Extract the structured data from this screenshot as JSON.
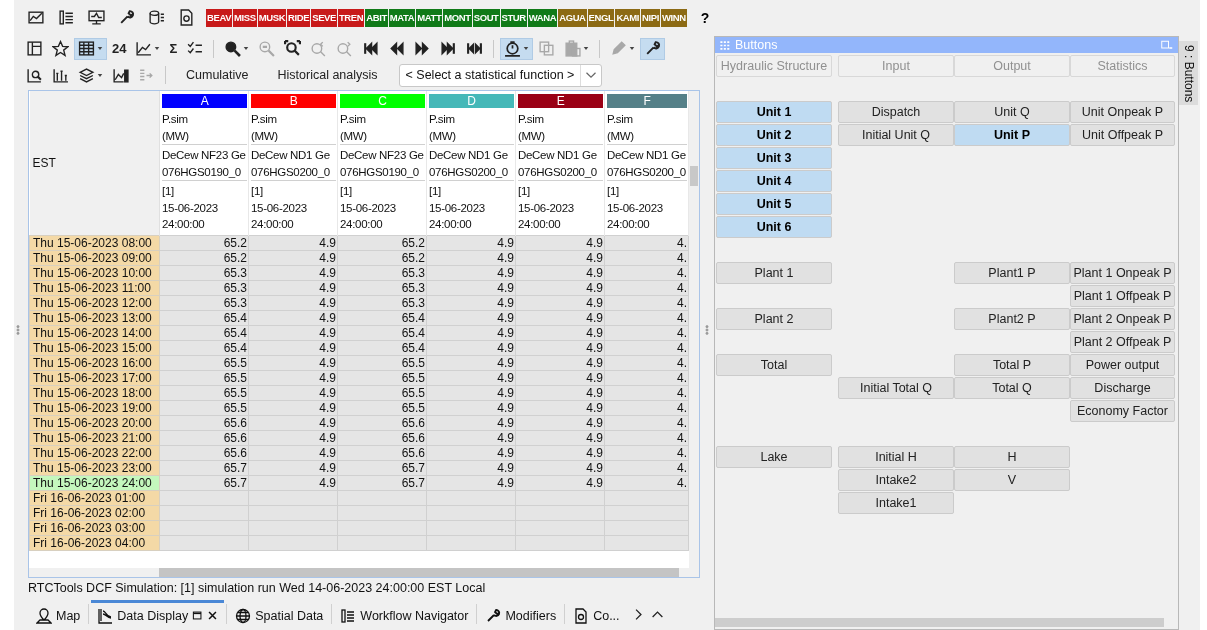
{
  "toolbar_1": {
    "groups": [
      {
        "items": [
          {
            "kind": "chart",
            "selected": false
          },
          {
            "kind": "list",
            "selected": false
          },
          {
            "kind": "monitor",
            "selected": false
          },
          {
            "kind": "wrench",
            "selected": false
          },
          {
            "kind": "database",
            "selected": false
          },
          {
            "kind": "document",
            "selected": false
          }
        ]
      }
    ],
    "tags": [
      {
        "label": "BEAV",
        "color": "#c81a1a"
      },
      {
        "label": "MISS",
        "color": "#c81a1a"
      },
      {
        "label": "MUSK",
        "color": "#c81a1a"
      },
      {
        "label": "RIDE",
        "color": "#c81a1a"
      },
      {
        "label": "SEVE",
        "color": "#c81a1a"
      },
      {
        "label": "TREN",
        "color": "#c81a1a"
      },
      {
        "label": "ABIT",
        "color": "#107a18"
      },
      {
        "label": "MATA",
        "color": "#107a18"
      },
      {
        "label": "MATT",
        "color": "#107a18"
      },
      {
        "label": "MONT",
        "color": "#107a18"
      },
      {
        "label": "SOUT",
        "color": "#107a18"
      },
      {
        "label": "STUR",
        "color": "#107a18"
      },
      {
        "label": "WANA",
        "color": "#107a18"
      },
      {
        "label": "AGUA",
        "color": "#8c6a14"
      },
      {
        "label": "ENGL",
        "color": "#8c6a14"
      },
      {
        "label": "KAMI",
        "color": "#8c6a14"
      },
      {
        "label": "NIPI",
        "color": "#8c6a14"
      },
      {
        "label": "WINN",
        "color": "#8c6a14"
      }
    ],
    "help": "?"
  },
  "toolbar_2": {
    "groups": [
      {
        "items": [
          {
            "kind": "layout",
            "selected": false
          },
          {
            "kind": "star",
            "selected": false
          },
          {
            "kind": "table",
            "selected": true,
            "dropdown": true
          },
          {
            "kind": "text",
            "label": "24",
            "selected": false
          },
          {
            "kind": "line-chart",
            "selected": false,
            "dropdown": true
          },
          {
            "kind": "text",
            "label": "Σ",
            "selected": false
          },
          {
            "kind": "checklist",
            "selected": false
          }
        ]
      },
      {
        "items": [
          {
            "kind": "zoom-in",
            "selected": false,
            "dropdown": true
          },
          {
            "kind": "zoom-out",
            "selected": false,
            "disabled": true
          },
          {
            "kind": "zoom-fit",
            "selected": false
          },
          {
            "kind": "zoom-back",
            "selected": false,
            "disabled": true
          },
          {
            "kind": "zoom-forward",
            "selected": false,
            "disabled": true
          },
          {
            "kind": "first",
            "selected": false
          },
          {
            "kind": "previous",
            "selected": false
          },
          {
            "kind": "next",
            "selected": false
          },
          {
            "kind": "last",
            "selected": false
          },
          {
            "kind": "skip",
            "selected": false
          }
        ]
      },
      {
        "items": [
          {
            "kind": "timer",
            "selected": true,
            "dropdown": true
          },
          {
            "kind": "copy",
            "selected": false,
            "disabled": true
          },
          {
            "kind": "paste",
            "selected": false,
            "disabled": true,
            "dropdown": true
          }
        ]
      },
      {
        "items": [
          {
            "kind": "pencil",
            "selected": false,
            "disabled": true,
            "dropdown": true
          },
          {
            "kind": "wrench",
            "selected": true
          }
        ]
      }
    ]
  },
  "toolbar_3": {
    "groups": [
      {
        "items": [
          {
            "kind": "chart-search",
            "selected": false
          },
          {
            "kind": "bar-axes",
            "selected": false
          },
          {
            "kind": "layers",
            "selected": false,
            "dropdown": true
          },
          {
            "kind": "chart-bars",
            "selected": false
          },
          {
            "kind": "arrow-list",
            "selected": false,
            "disabled": true
          }
        ]
      }
    ],
    "buttons": [
      "Cumulative",
      "Historical analysis"
    ],
    "statistic_select": {
      "value": "< Select a statistical function >"
    }
  },
  "table": {
    "corner": "EST",
    "columns": [
      {
        "letter": "A",
        "color": "#0000ff",
        "parameter": "P.sim",
        "unit": "(MW)",
        "location": "DeCew NF23 Ge",
        "location_id": "076HGS0190_0",
        "ensemble": "[1]",
        "date": "15-06-2023",
        "time": "24:00:00"
      },
      {
        "letter": "B",
        "color": "#ff0000",
        "parameter": "P.sim",
        "unit": "(MW)",
        "location": "DeCew ND1 Ge",
        "location_id": "076HGS0200_0",
        "ensemble": "[1]",
        "date": "15-06-2023",
        "time": "24:00:00"
      },
      {
        "letter": "C",
        "color": "#00ff00",
        "parameter": "P.sim",
        "unit": "(MW)",
        "location": "DeCew NF23 Ge",
        "location_id": "076HGS0190_0",
        "ensemble": "[1]",
        "date": "15-06-2023",
        "time": "24:00:00"
      },
      {
        "letter": "D",
        "color": "#45b8b8",
        "parameter": "P.sim",
        "unit": "(MW)",
        "location": "DeCew ND1 Ge",
        "location_id": "076HGS0200_0",
        "ensemble": "[1]",
        "date": "15-06-2023",
        "time": "24:00:00"
      },
      {
        "letter": "E",
        "color": "#9a0015",
        "parameter": "P.sim",
        "unit": "(MW)",
        "location": "DeCew ND1 Ge",
        "location_id": "076HGS0200_0",
        "ensemble": "[1]",
        "date": "15-06-2023",
        "time": "24:00:00"
      },
      {
        "letter": "F",
        "color": "#558088",
        "parameter": "P.sim",
        "unit": "(MW)",
        "location": "DeCew ND1 Ge",
        "location_id": "076HGS0200_0",
        "ensemble": "[1]",
        "date": "15-06-2023",
        "time": "24:00:00"
      }
    ],
    "rows": [
      {
        "time": "Thu 15-06-2023 08:00",
        "current": false,
        "values": [
          "65.2",
          "4.9",
          "65.2",
          "4.9",
          "4.9",
          "4."
        ]
      },
      {
        "time": "Thu 15-06-2023 09:00",
        "current": false,
        "values": [
          "65.2",
          "4.9",
          "65.2",
          "4.9",
          "4.9",
          "4."
        ]
      },
      {
        "time": "Thu 15-06-2023 10:00",
        "current": false,
        "values": [
          "65.3",
          "4.9",
          "65.3",
          "4.9",
          "4.9",
          "4."
        ]
      },
      {
        "time": "Thu 15-06-2023 11:00",
        "current": false,
        "values": [
          "65.3",
          "4.9",
          "65.3",
          "4.9",
          "4.9",
          "4."
        ]
      },
      {
        "time": "Thu 15-06-2023 12:00",
        "current": false,
        "values": [
          "65.3",
          "4.9",
          "65.3",
          "4.9",
          "4.9",
          "4."
        ]
      },
      {
        "time": "Thu 15-06-2023 13:00",
        "current": false,
        "values": [
          "65.4",
          "4.9",
          "65.4",
          "4.9",
          "4.9",
          "4."
        ]
      },
      {
        "time": "Thu 15-06-2023 14:00",
        "current": false,
        "values": [
          "65.4",
          "4.9",
          "65.4",
          "4.9",
          "4.9",
          "4."
        ]
      },
      {
        "time": "Thu 15-06-2023 15:00",
        "current": false,
        "values": [
          "65.4",
          "4.9",
          "65.4",
          "4.9",
          "4.9",
          "4."
        ]
      },
      {
        "time": "Thu 15-06-2023 16:00",
        "current": false,
        "values": [
          "65.5",
          "4.9",
          "65.5",
          "4.9",
          "4.9",
          "4."
        ]
      },
      {
        "time": "Thu 15-06-2023 17:00",
        "current": false,
        "values": [
          "65.5",
          "4.9",
          "65.5",
          "4.9",
          "4.9",
          "4."
        ]
      },
      {
        "time": "Thu 15-06-2023 18:00",
        "current": false,
        "values": [
          "65.5",
          "4.9",
          "65.5",
          "4.9",
          "4.9",
          "4."
        ]
      },
      {
        "time": "Thu 15-06-2023 19:00",
        "current": false,
        "values": [
          "65.5",
          "4.9",
          "65.5",
          "4.9",
          "4.9",
          "4."
        ]
      },
      {
        "time": "Thu 15-06-2023 20:00",
        "current": false,
        "values": [
          "65.6",
          "4.9",
          "65.6",
          "4.9",
          "4.9",
          "4."
        ]
      },
      {
        "time": "Thu 15-06-2023 21:00",
        "current": false,
        "values": [
          "65.6",
          "4.9",
          "65.6",
          "4.9",
          "4.9",
          "4."
        ]
      },
      {
        "time": "Thu 15-06-2023 22:00",
        "current": false,
        "values": [
          "65.6",
          "4.9",
          "65.6",
          "4.9",
          "4.9",
          "4."
        ]
      },
      {
        "time": "Thu 15-06-2023 23:00",
        "current": false,
        "values": [
          "65.7",
          "4.9",
          "65.7",
          "4.9",
          "4.9",
          "4."
        ]
      },
      {
        "time": "Thu 15-06-2023 24:00",
        "current": true,
        "values": [
          "65.7",
          "4.9",
          "65.7",
          "4.9",
          "4.9",
          "4."
        ]
      },
      {
        "time": "Fri 16-06-2023 01:00",
        "current": false
      },
      {
        "time": "Fri 16-06-2023 02:00",
        "current": false
      },
      {
        "time": "Fri 16-06-2023 03:00",
        "current": false
      },
      {
        "time": "Fri 16-06-2023 04:00",
        "current": false
      }
    ]
  },
  "status_bar": "RTCTools DCF Simulation: [1] simulation run Wed 14-06-2023 24:00:00 EST Local",
  "bottom_tabs": [
    {
      "label": "Map",
      "kind": "pin",
      "selected": false,
      "closable": false
    },
    {
      "label": "Data Display",
      "kind": "chart-lines",
      "selected": true,
      "closable": true
    },
    {
      "label": "Spatial Data",
      "kind": "globe",
      "selected": false,
      "closable": false
    },
    {
      "label": "Workflow Navigator",
      "kind": "list",
      "selected": false,
      "closable": false
    },
    {
      "label": "Modifiers",
      "kind": "wrench",
      "selected": false,
      "closable": false
    },
    {
      "label": "Co...",
      "kind": "document",
      "selected": false,
      "closable": false
    }
  ],
  "buttons_panel": {
    "title": "Buttons",
    "side_tab": "9 : Buttons",
    "rows": [
      {
        "kind": "header",
        "cells": [
          {
            "label": "Hydraulic Structure"
          },
          {
            "label": "Input"
          },
          {
            "label": "Output"
          },
          {
            "label": "Statistics"
          }
        ]
      },
      {
        "kind": "spacer"
      },
      {
        "kind": "buttons",
        "cells": [
          {
            "label": "Unit 1",
            "selected": true
          },
          {
            "label": "Dispatch",
            "selected": false
          },
          {
            "label": "Unit Q",
            "selected": false
          },
          {
            "label": "Unit Onpeak P",
            "selected": false
          }
        ]
      },
      {
        "kind": "buttons",
        "cells": [
          {
            "label": "Unit 2",
            "selected": true
          },
          {
            "label": "Initial Unit Q",
            "selected": false
          },
          {
            "label": "Unit P",
            "selected": true
          },
          {
            "label": "Unit Offpeak P",
            "selected": false
          }
        ]
      },
      {
        "kind": "buttons",
        "cells": [
          {
            "label": "Unit 3",
            "selected": true
          },
          null,
          null,
          null
        ]
      },
      {
        "kind": "buttons",
        "cells": [
          {
            "label": "Unit 4",
            "selected": true
          },
          null,
          null,
          null
        ]
      },
      {
        "kind": "buttons",
        "cells": [
          {
            "label": "Unit 5",
            "selected": true
          },
          null,
          null,
          null
        ]
      },
      {
        "kind": "buttons",
        "cells": [
          {
            "label": "Unit 6",
            "selected": true
          },
          null,
          null,
          null
        ]
      },
      {
        "kind": "spacer"
      },
      {
        "kind": "buttons",
        "cells": [
          {
            "label": "Plant 1",
            "selected": false
          },
          null,
          {
            "label": "Plant1 P",
            "selected": false
          },
          {
            "label": "Plant 1 Onpeak P",
            "selected": false
          }
        ]
      },
      {
        "kind": "buttons",
        "cells": [
          null,
          null,
          null,
          {
            "label": "Plant 1 Offpeak P",
            "selected": false
          }
        ]
      },
      {
        "kind": "buttons",
        "cells": [
          {
            "label": "Plant 2",
            "selected": false
          },
          null,
          {
            "label": "Plant2 P",
            "selected": false
          },
          {
            "label": "Plant 2 Onpeak P",
            "selected": false
          }
        ]
      },
      {
        "kind": "buttons",
        "cells": [
          null,
          null,
          null,
          {
            "label": "Plant 2 Offpeak P",
            "selected": false
          }
        ]
      },
      {
        "kind": "buttons",
        "cells": [
          {
            "label": "Total",
            "selected": false
          },
          null,
          {
            "label": "Total P",
            "selected": false
          },
          {
            "label": "Power output",
            "selected": false
          }
        ]
      },
      {
        "kind": "buttons",
        "cells": [
          null,
          {
            "label": "Initial Total Q",
            "selected": false
          },
          {
            "label": "Total Q",
            "selected": false
          },
          {
            "label": "Discharge",
            "selected": false
          }
        ]
      },
      {
        "kind": "buttons",
        "cells": [
          null,
          null,
          null,
          {
            "label": "Economy Factor",
            "selected": false
          }
        ]
      },
      {
        "kind": "spacer"
      },
      {
        "kind": "buttons",
        "cells": [
          {
            "label": "Lake",
            "selected": false
          },
          {
            "label": "Initial H",
            "selected": false
          },
          {
            "label": "H",
            "selected": false
          },
          null
        ]
      },
      {
        "kind": "buttons",
        "cells": [
          null,
          {
            "label": "Intake2",
            "selected": false
          },
          {
            "label": "V",
            "selected": false
          },
          null
        ]
      },
      {
        "kind": "buttons",
        "cells": [
          null,
          {
            "label": "Intake1",
            "selected": false
          },
          null,
          null
        ]
      }
    ]
  }
}
